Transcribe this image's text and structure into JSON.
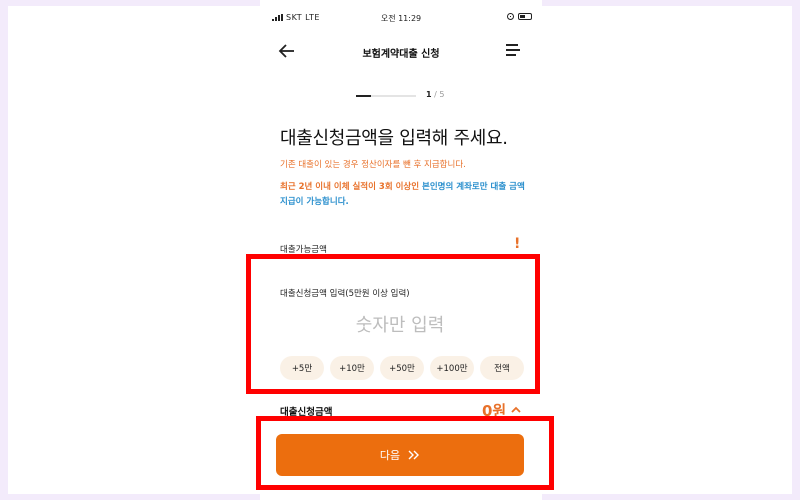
{
  "status_bar": {
    "carrier": "SKT  LTE",
    "time": "오전 11:29"
  },
  "header": {
    "title": "보험계약대출 신청",
    "back_icon": "arrow-left-icon",
    "menu_icon": "hamburger-menu-icon"
  },
  "progress": {
    "current": "1",
    "total": "/ 5",
    "fraction": 0.25
  },
  "main": {
    "headline": "대출신청금액을 입력해 주세요.",
    "notice": "기존 대출이 있는 경우 정산이자를 뺀 후 지급합니다.",
    "warning_orange": "최근 2년 이내 이체 실적이 3회 이상인",
    "warning_blue": "본인명의 계좌로만 대출 금액 지급이 가능합니다.",
    "available_label": "대출가능금액",
    "available_mark": "!"
  },
  "input": {
    "label": "대출신청금액 입력(5만원 이상 입력)",
    "placeholder": "숫자만 입력",
    "value": ""
  },
  "chips": [
    {
      "label": "+5만"
    },
    {
      "label": "+10만"
    },
    {
      "label": "+50만"
    },
    {
      "label": "+100만"
    },
    {
      "label": "전액"
    }
  ],
  "total": {
    "label": "대출신청금액",
    "value": "0원"
  },
  "next_button": {
    "label": "다음",
    "icon": "double-chevron-right-icon"
  },
  "colors": {
    "accent": "#ec6e0e",
    "accent_text": "#e8712a",
    "info_blue": "#2a8fcd",
    "highlight_red": "#ff0000",
    "chip_bg": "#faf1e6"
  }
}
